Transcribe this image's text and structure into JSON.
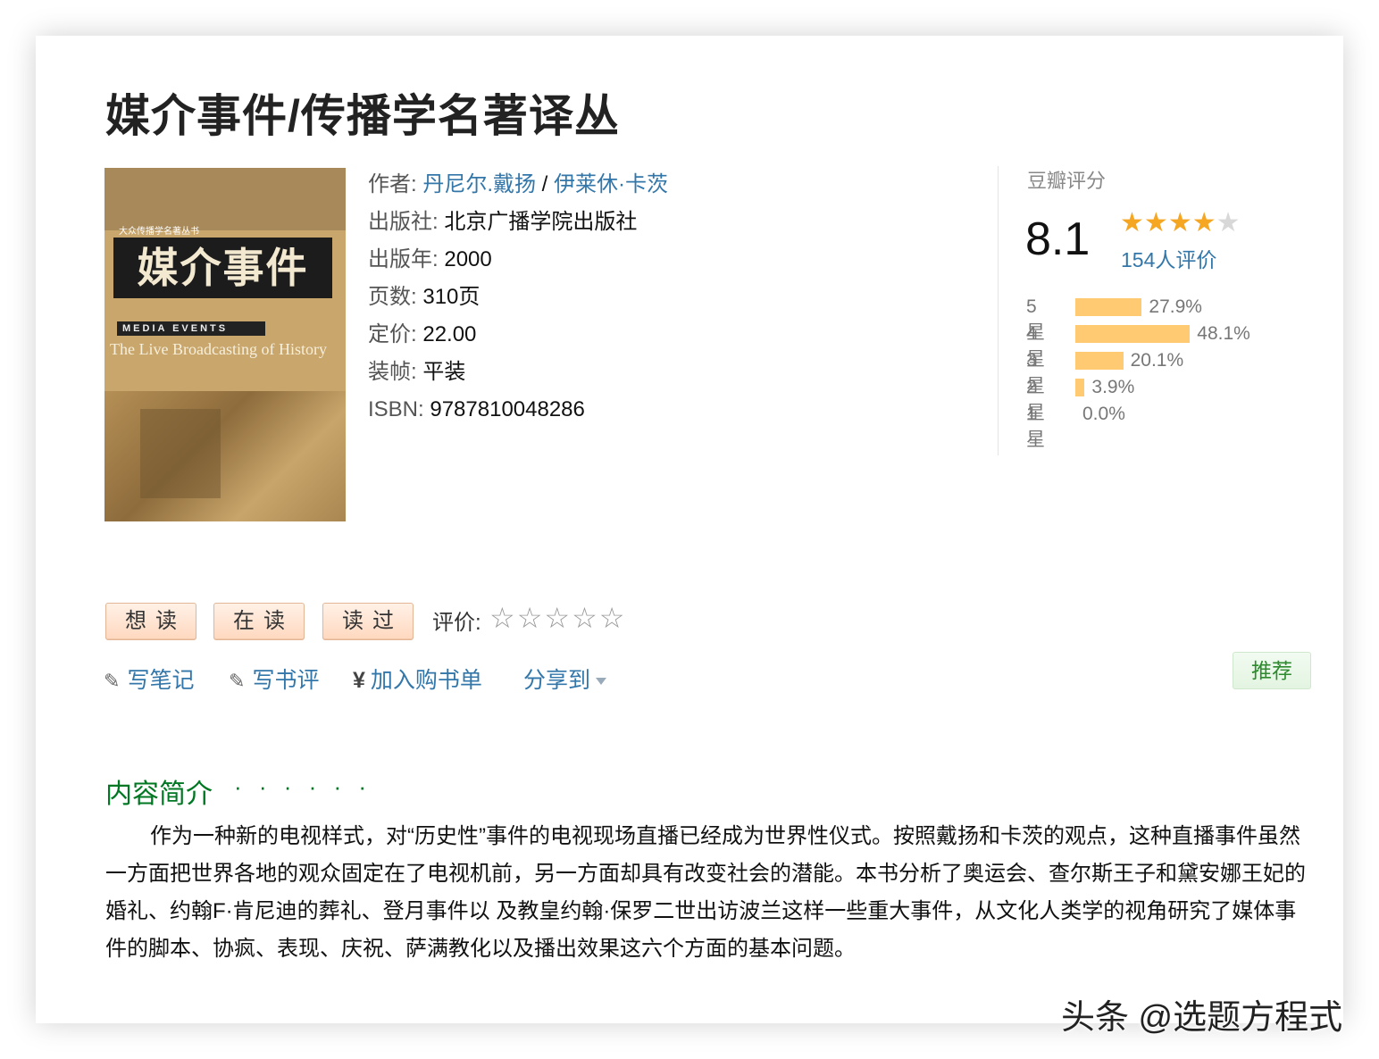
{
  "book": {
    "title": "媒介事件/传播学名著译丛",
    "cover": {
      "series": "大众传播学名著丛书",
      "title": "媒介事件",
      "en_line1": "MEDIA EVENTS",
      "en_line2": "The Live Broadcasting of History"
    },
    "info": {
      "author_label": "作者:",
      "author_1": "丹尼尔.戴扬",
      "author_sep": " / ",
      "author_2": "伊莱休·卡茨",
      "publisher_label": "出版社:",
      "publisher": "北京广播学院出版社",
      "year_label": "出版年:",
      "year": "2000",
      "pages_label": "页数:",
      "pages": "310页",
      "price_label": "定价:",
      "price": "22.00",
      "binding_label": "装帧:",
      "binding": "平装",
      "isbn_label": "ISBN:",
      "isbn": "9787810048286"
    }
  },
  "rating": {
    "label": "豆瓣评分",
    "score": "8.1",
    "stars_filled": 4,
    "votes": "154人评价",
    "distribution": [
      {
        "label": "5星",
        "pct_text": "27.9%",
        "pct": 27.9
      },
      {
        "label": "4星",
        "pct_text": "48.1%",
        "pct": 48.1
      },
      {
        "label": "3星",
        "pct_text": "20.1%",
        "pct": 20.1
      },
      {
        "label": "2星",
        "pct_text": "3.9%",
        "pct": 3.9
      },
      {
        "label": "1星",
        "pct_text": "0.0%",
        "pct": 0.0
      }
    ]
  },
  "buttons": {
    "want": "想读",
    "reading": "在读",
    "read": "读过",
    "rate_label": "评价:",
    "rate_stars": "☆☆☆☆☆"
  },
  "actions": {
    "note": "写笔记",
    "review": "写书评",
    "cart_symbol": "¥",
    "cart": "加入购书单",
    "share": "分享到",
    "recommend": "推荐"
  },
  "intro": {
    "title": "内容简介",
    "dots": "· · · · · ·",
    "text": "作为一种新的电视样式，对“历史性”事件的电视现场直播已经成为世界性仪式。按照戴扬和卡茨的观点，这种直播事件虽然一方面把世界各地的观众固定在了电视机前，另一方面却具有改变社会的潜能。本书分析了奥运会、查尔斯王子和黛安娜王妃的婚礼、约翰F·肯尼迪的葬礼、登月事件以 及教皇约翰·保罗二世出访波兰这样一些重大事件，从文化人类学的视角研究了媒体事件的脚本、协疯、表现、庆祝、萨满教化以及播出效果这六个方面的基本问题。"
  },
  "watermark": "头条 @选题方程式"
}
